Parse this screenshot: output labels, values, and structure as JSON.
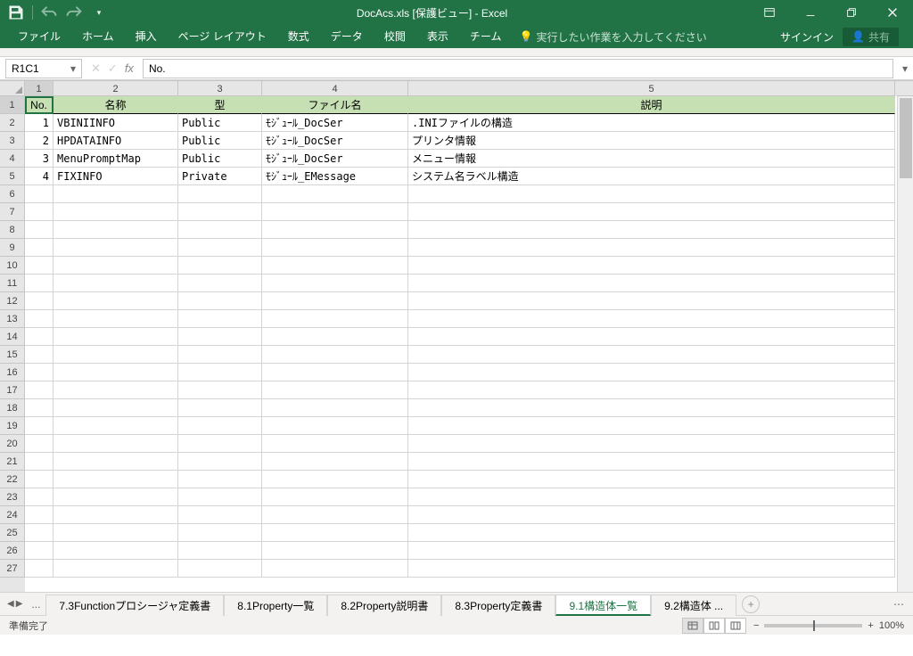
{
  "title": "DocAcs.xls [保護ビュー] - Excel",
  "qat": {
    "save": "save",
    "undo": "undo",
    "redo": "redo"
  },
  "win": {
    "ribbon_opts": "ribbon-display-options",
    "min": "minimize",
    "restore": "restore",
    "close": "close"
  },
  "ribbon": {
    "tabs": [
      "ファイル",
      "ホーム",
      "挿入",
      "ページ レイアウト",
      "数式",
      "データ",
      "校閲",
      "表示",
      "チーム"
    ],
    "tell_me": "実行したい作業を入力してください",
    "sign_in": "サインイン",
    "share": "共有"
  },
  "fx": {
    "namebox": "R1C1",
    "formula": "No."
  },
  "columns": {
    "labels": [
      "1",
      "2",
      "3",
      "4",
      "5"
    ],
    "widths": [
      32,
      140,
      94,
      164,
      546
    ]
  },
  "header_row": [
    "No.",
    "名称",
    "型",
    "ファイル名",
    "説明"
  ],
  "rows": [
    {
      "no": "1",
      "name": "VBINIINFO",
      "type": "Public",
      "file": "ﾓｼﾞｭｰﾙ_DocSer",
      "desc": ".INIファイルの構造"
    },
    {
      "no": "2",
      "name": "HPDATAINFO",
      "type": "Public",
      "file": "ﾓｼﾞｭｰﾙ_DocSer",
      "desc": "プリンタ情報"
    },
    {
      "no": "3",
      "name": "MenuPromptMap",
      "type": "Public",
      "file": "ﾓｼﾞｭｰﾙ_DocSer",
      "desc": "メニュー情報"
    },
    {
      "no": "4",
      "name": "FIXINFO",
      "type": "Private",
      "file": "ﾓｼﾞｭｰﾙ_EMessage",
      "desc": "システム名ラベル構造"
    }
  ],
  "visible_row_count": 27,
  "sheet_tabs": {
    "prev_more": "...",
    "tabs": [
      "7.3Functionプロシージャ定義書",
      "8.1Property一覧",
      "8.2Property説明書",
      "8.3Property定義書",
      "9.1構造体一覧",
      "9.2構造体 ..."
    ],
    "active_index": 4
  },
  "status": {
    "left": "準備完了",
    "zoom": "100%"
  }
}
